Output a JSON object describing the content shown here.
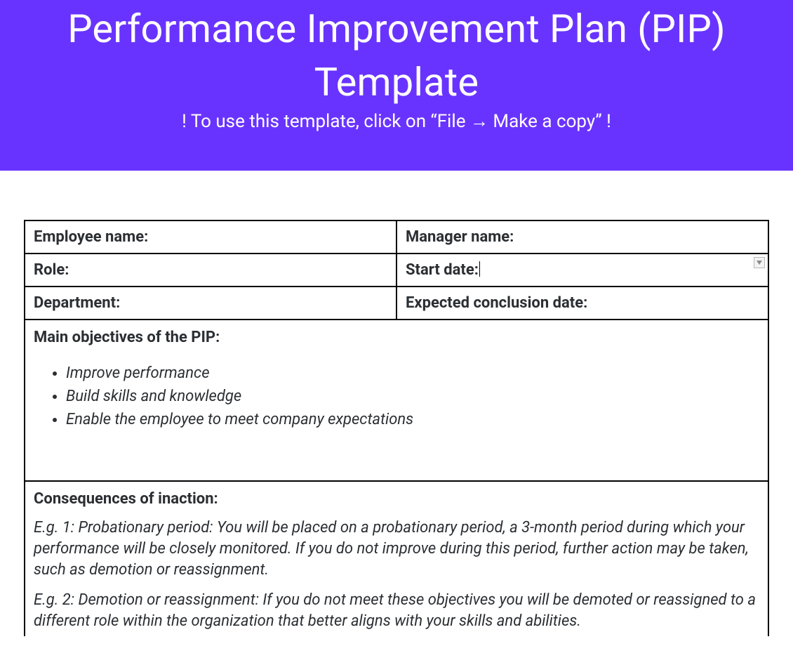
{
  "banner": {
    "title": "Performance Improvement Plan (PIP) Template",
    "hint": "! To use this template, click on “File → Make a copy” !"
  },
  "info": {
    "employee_name_label": "Employee name:",
    "manager_name_label": "Manager name:",
    "role_label": "Role:",
    "start_date_label": "Start date:",
    "department_label": "Department:",
    "expected_conclusion_label": "Expected conclusion date:"
  },
  "objectives": {
    "heading": "Main objectives of the PIP:",
    "items": [
      "Improve performance",
      "Build skills and knowledge",
      "Enable the employee to meet company expectations"
    ]
  },
  "consequences": {
    "heading": "Consequences of inaction:",
    "examples": [
      "E.g. 1: Probationary period: You will be placed on a probationary period, a 3-month period during which your performance will be closely monitored. If you do not improve during this period, further action may be taken, such as demotion or reassignment.",
      "E.g. 2: Demotion or reassignment: If you do not meet these objectives you will be demoted or reassigned to a different role within the organization that better aligns with your skills and abilities."
    ]
  }
}
